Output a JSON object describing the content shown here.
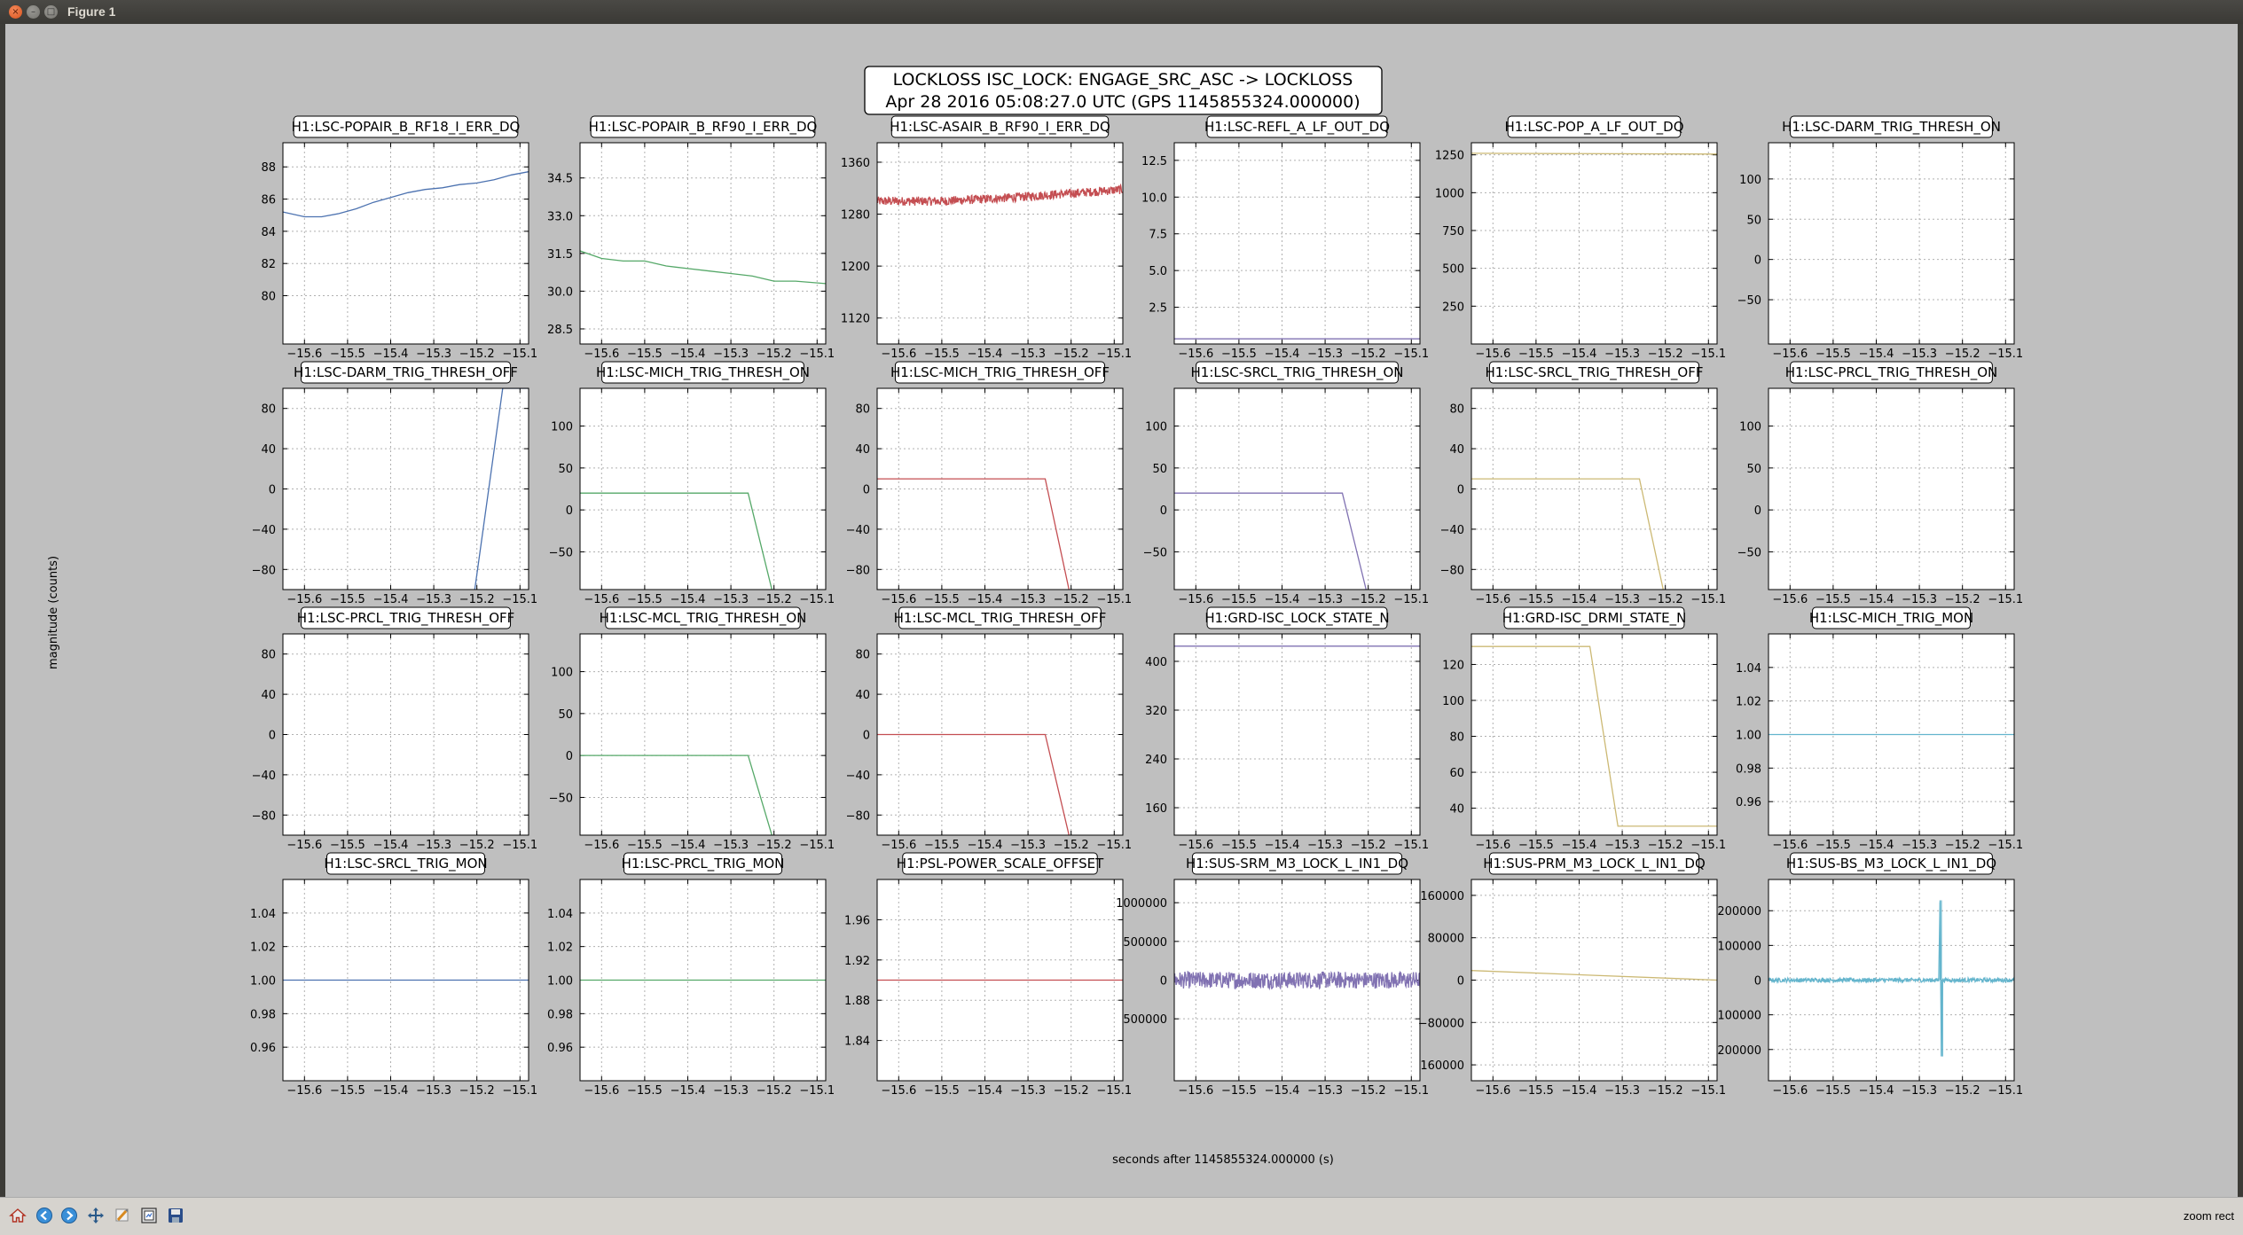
{
  "window": {
    "title": "Figure 1"
  },
  "figure": {
    "suptitle_line1": "LOCKLOSS ISC_LOCK: ENGAGE_SRC_ASC -> LOCKLOSS",
    "suptitle_line2": "Apr 28 2016 05:08:27.0 UTC (GPS 1145855324.000000)",
    "ylabel": "magnitude (counts)",
    "xlabel": "seconds after 1145855324.000000 (s)"
  },
  "toolbar": {
    "status": "zoom rect",
    "icons": [
      "home-icon",
      "back-icon",
      "forward-icon",
      "pan-icon",
      "zoom-icon",
      "subplots-icon",
      "save-icon"
    ]
  },
  "chart_data": [
    {
      "type": "line",
      "title": "H1:LSC-POPAIR_B_RF18_I_ERR_DQ",
      "color": "#4c72b0",
      "xlim": [
        -15.65,
        -15.08
      ],
      "ylim": [
        77,
        89.5
      ],
      "xticks": [
        -15.6,
        -15.5,
        -15.4,
        -15.3,
        -15.2,
        -15.1
      ],
      "xtick_labels": [
        "−15.6",
        "−15.5",
        "−15.4",
        "−15.3",
        "−15.2",
        "−15.1"
      ],
      "yticks": [
        80,
        82,
        84,
        86,
        88
      ],
      "ytick_labels": [
        "80",
        "82",
        "84",
        "86",
        "88"
      ],
      "x": [
        -15.65,
        -15.6,
        -15.56,
        -15.52,
        -15.48,
        -15.44,
        -15.4,
        -15.36,
        -15.32,
        -15.28,
        -15.24,
        -15.2,
        -15.16,
        -15.12,
        -15.08
      ],
      "y": [
        85.2,
        84.9,
        84.9,
        85.1,
        85.4,
        85.8,
        86.1,
        86.4,
        86.6,
        86.7,
        86.9,
        87.0,
        87.2,
        87.5,
        87.7
      ]
    },
    {
      "type": "line",
      "title": "H1:LSC-POPAIR_B_RF90_I_ERR_DQ",
      "color": "#55a868",
      "xlim": [
        -15.65,
        -15.08
      ],
      "ylim": [
        27.9,
        35.9
      ],
      "xticks": [
        -15.6,
        -15.5,
        -15.4,
        -15.3,
        -15.2,
        -15.1
      ],
      "xtick_labels": [
        "−15.6",
        "−15.5",
        "−15.4",
        "−15.3",
        "−15.2",
        "−15.1"
      ],
      "yticks": [
        28.5,
        30.0,
        31.5,
        33.0,
        34.5
      ],
      "ytick_labels": [
        "28.5",
        "30.0",
        "31.5",
        "33.0",
        "34.5"
      ],
      "x": [
        -15.65,
        -15.6,
        -15.55,
        -15.5,
        -15.45,
        -15.4,
        -15.35,
        -15.3,
        -15.25,
        -15.2,
        -15.15,
        -15.08
      ],
      "y": [
        31.6,
        31.3,
        31.2,
        31.2,
        31.0,
        30.9,
        30.8,
        30.7,
        30.6,
        30.4,
        30.4,
        30.3
      ]
    },
    {
      "type": "line",
      "title": "H1:LSC-ASAIR_B_RF90_I_ERR_DQ",
      "color": "#c44e52",
      "xlim": [
        -15.65,
        -15.08
      ],
      "ylim": [
        1080,
        1390
      ],
      "xticks": [
        -15.6,
        -15.5,
        -15.4,
        -15.3,
        -15.2,
        -15.1
      ],
      "xtick_labels": [
        "−15.6",
        "−15.5",
        "−15.4",
        "−15.3",
        "−15.2",
        "−15.1"
      ],
      "yticks": [
        1120,
        1200,
        1280,
        1360
      ],
      "ytick_labels": [
        "1120",
        "1200",
        "1280",
        "1360"
      ],
      "noise": "dense",
      "x": [
        -15.65,
        -15.5,
        -15.35,
        -15.2,
        -15.08
      ],
      "y": [
        1300,
        1300,
        1305,
        1312,
        1318
      ],
      "noise_amplitude": 7
    },
    {
      "type": "line",
      "title": "H1:LSC-REFL_A_LF_OUT_DQ",
      "color": "#8172b2",
      "xlim": [
        -15.65,
        -15.08
      ],
      "ylim": [
        0,
        13.7
      ],
      "xticks": [
        -15.6,
        -15.5,
        -15.4,
        -15.3,
        -15.2,
        -15.1
      ],
      "xtick_labels": [
        "−15.6",
        "−15.5",
        "−15.4",
        "−15.3",
        "−15.2",
        "−15.1"
      ],
      "yticks": [
        2.5,
        5.0,
        7.5,
        10.0,
        12.5
      ],
      "ytick_labels": [
        "2.5",
        "5.0",
        "7.5",
        "10.0",
        "12.5"
      ],
      "x": [
        -15.65,
        -15.08
      ],
      "y": [
        0.35,
        0.35
      ]
    },
    {
      "type": "line",
      "title": "H1:LSC-POP_A_LF_OUT_DQ",
      "color": "#ccb974",
      "xlim": [
        -15.65,
        -15.08
      ],
      "ylim": [
        0,
        1330
      ],
      "xticks": [
        -15.6,
        -15.5,
        -15.4,
        -15.3,
        -15.2,
        -15.1
      ],
      "xtick_labels": [
        "−15.6",
        "−15.5",
        "−15.4",
        "−15.3",
        "−15.2",
        "−15.1"
      ],
      "yticks": [
        250,
        500,
        750,
        1000,
        1250
      ],
      "ytick_labels": [
        "250",
        "500",
        "750",
        "1000",
        "1250"
      ],
      "x": [
        -15.65,
        -15.08
      ],
      "y": [
        1260,
        1255
      ]
    },
    {
      "type": "line",
      "title": "H1:LSC-DARM_TRIG_THRESH_ON",
      "color": "#64b5cd",
      "xlim": [
        -15.65,
        -15.08
      ],
      "ylim": [
        -105,
        145
      ],
      "xticks": [
        -15.6,
        -15.5,
        -15.4,
        -15.3,
        -15.2,
        -15.1
      ],
      "xtick_labels": [
        "−15.6",
        "−15.5",
        "−15.4",
        "−15.3",
        "−15.2",
        "−15.1"
      ],
      "yticks": [
        -50,
        0,
        50,
        100
      ],
      "ytick_labels": [
        "−50",
        "0",
        "50",
        "100"
      ],
      "x": [],
      "y": []
    },
    {
      "type": "line",
      "title": "H1:LSC-DARM_TRIG_THRESH_OFF",
      "color": "#4c72b0",
      "xlim": [
        -15.65,
        -15.08
      ],
      "ylim": [
        -100,
        100
      ],
      "xticks": [
        -15.6,
        -15.5,
        -15.4,
        -15.3,
        -15.2,
        -15.1
      ],
      "xtick_labels": [
        "−15.6",
        "−15.5",
        "−15.4",
        "−15.3",
        "−15.2",
        "−15.1"
      ],
      "yticks": [
        -80,
        -40,
        0,
        40,
        80
      ],
      "ytick_labels": [
        "−80",
        "−40",
        "0",
        "40",
        "80"
      ],
      "x": [
        -15.205,
        -15.14,
        -15.08
      ],
      "y": [
        -100,
        100,
        100
      ]
    },
    {
      "type": "line",
      "title": "H1:LSC-MICH_TRIG_THRESH_ON",
      "color": "#55a868",
      "xlim": [
        -15.65,
        -15.08
      ],
      "ylim": [
        -95,
        145
      ],
      "xticks": [
        -15.6,
        -15.5,
        -15.4,
        -15.3,
        -15.2,
        -15.1
      ],
      "xtick_labels": [
        "−15.6",
        "−15.5",
        "−15.4",
        "−15.3",
        "−15.2",
        "−15.1"
      ],
      "yticks": [
        -50,
        0,
        50,
        100
      ],
      "ytick_labels": [
        "−50",
        "0",
        "50",
        "100"
      ],
      "x": [
        -15.65,
        -15.26,
        -15.205
      ],
      "y": [
        20,
        20,
        -95
      ]
    },
    {
      "type": "line",
      "title": "H1:LSC-MICH_TRIG_THRESH_OFF",
      "color": "#c44e52",
      "xlim": [
        -15.65,
        -15.08
      ],
      "ylim": [
        -100,
        100
      ],
      "xticks": [
        -15.6,
        -15.5,
        -15.4,
        -15.3,
        -15.2,
        -15.1
      ],
      "xtick_labels": [
        "−15.6",
        "−15.5",
        "−15.4",
        "−15.3",
        "−15.2",
        "−15.1"
      ],
      "yticks": [
        -80,
        -40,
        0,
        40,
        80
      ],
      "ytick_labels": [
        "−80",
        "−40",
        "0",
        "40",
        "80"
      ],
      "x": [
        -15.65,
        -15.26,
        -15.205
      ],
      "y": [
        10,
        10,
        -100
      ]
    },
    {
      "type": "line",
      "title": "H1:LSC-SRCL_TRIG_THRESH_ON",
      "color": "#8172b2",
      "xlim": [
        -15.65,
        -15.08
      ],
      "ylim": [
        -95,
        145
      ],
      "xticks": [
        -15.6,
        -15.5,
        -15.4,
        -15.3,
        -15.2,
        -15.1
      ],
      "xtick_labels": [
        "−15.6",
        "−15.5",
        "−15.4",
        "−15.3",
        "−15.2",
        "−15.1"
      ],
      "yticks": [
        -50,
        0,
        50,
        100
      ],
      "ytick_labels": [
        "−50",
        "0",
        "50",
        "100"
      ],
      "x": [
        -15.65,
        -15.26,
        -15.205
      ],
      "y": [
        20,
        20,
        -95
      ]
    },
    {
      "type": "line",
      "title": "H1:LSC-SRCL_TRIG_THRESH_OFF",
      "color": "#ccb974",
      "xlim": [
        -15.65,
        -15.08
      ],
      "ylim": [
        -100,
        100
      ],
      "xticks": [
        -15.6,
        -15.5,
        -15.4,
        -15.3,
        -15.2,
        -15.1
      ],
      "xtick_labels": [
        "−15.6",
        "−15.5",
        "−15.4",
        "−15.3",
        "−15.2",
        "−15.1"
      ],
      "yticks": [
        -80,
        -40,
        0,
        40,
        80
      ],
      "ytick_labels": [
        "−80",
        "−40",
        "0",
        "40",
        "80"
      ],
      "x": [
        -15.65,
        -15.26,
        -15.205
      ],
      "y": [
        10,
        10,
        -100
      ]
    },
    {
      "type": "line",
      "title": "H1:LSC-PRCL_TRIG_THRESH_ON",
      "color": "#64b5cd",
      "xlim": [
        -15.65,
        -15.08
      ],
      "ylim": [
        -95,
        145
      ],
      "xticks": [
        -15.6,
        -15.5,
        -15.4,
        -15.3,
        -15.2,
        -15.1
      ],
      "xtick_labels": [
        "−15.6",
        "−15.5",
        "−15.4",
        "−15.3",
        "−15.2",
        "−15.1"
      ],
      "yticks": [
        -50,
        0,
        50,
        100
      ],
      "ytick_labels": [
        "−50",
        "0",
        "50",
        "100"
      ],
      "x": [],
      "y": []
    },
    {
      "type": "line",
      "title": "H1:LSC-PRCL_TRIG_THRESH_OFF",
      "color": "#4c72b0",
      "xlim": [
        -15.65,
        -15.08
      ],
      "ylim": [
        -100,
        100
      ],
      "xticks": [
        -15.6,
        -15.5,
        -15.4,
        -15.3,
        -15.2,
        -15.1
      ],
      "xtick_labels": [
        "−15.6",
        "−15.5",
        "−15.4",
        "−15.3",
        "−15.2",
        "−15.1"
      ],
      "yticks": [
        -80,
        -40,
        0,
        40,
        80
      ],
      "ytick_labels": [
        "−80",
        "−40",
        "0",
        "40",
        "80"
      ],
      "x": [],
      "y": []
    },
    {
      "type": "line",
      "title": "H1:LSC-MCL_TRIG_THRESH_ON",
      "color": "#55a868",
      "xlim": [
        -15.65,
        -15.08
      ],
      "ylim": [
        -95,
        145
      ],
      "xticks": [
        -15.6,
        -15.5,
        -15.4,
        -15.3,
        -15.2,
        -15.1
      ],
      "xtick_labels": [
        "−15.6",
        "−15.5",
        "−15.4",
        "−15.3",
        "−15.2",
        "−15.1"
      ],
      "yticks": [
        -50,
        0,
        50,
        100
      ],
      "ytick_labels": [
        "−50",
        "0",
        "50",
        "100"
      ],
      "x": [
        -15.65,
        -15.26,
        -15.205
      ],
      "y": [
        0,
        0,
        -95
      ]
    },
    {
      "type": "line",
      "title": "H1:LSC-MCL_TRIG_THRESH_OFF",
      "color": "#c44e52",
      "xlim": [
        -15.65,
        -15.08
      ],
      "ylim": [
        -100,
        100
      ],
      "xticks": [
        -15.6,
        -15.5,
        -15.4,
        -15.3,
        -15.2,
        -15.1
      ],
      "xtick_labels": [
        "−15.6",
        "−15.5",
        "−15.4",
        "−15.3",
        "−15.2",
        "−15.1"
      ],
      "yticks": [
        -80,
        -40,
        0,
        40,
        80
      ],
      "ytick_labels": [
        "−80",
        "−40",
        "0",
        "40",
        "80"
      ],
      "x": [
        -15.65,
        -15.26,
        -15.205
      ],
      "y": [
        0,
        0,
        -100
      ]
    },
    {
      "type": "line",
      "title": "H1:GRD-ISC_LOCK_STATE_N",
      "color": "#8172b2",
      "xlim": [
        -15.65,
        -15.08
      ],
      "ylim": [
        115,
        445
      ],
      "xticks": [
        -15.6,
        -15.5,
        -15.4,
        -15.3,
        -15.2,
        -15.1
      ],
      "xtick_labels": [
        "−15.6",
        "−15.5",
        "−15.4",
        "−15.3",
        "−15.2",
        "−15.1"
      ],
      "yticks": [
        160,
        240,
        320,
        400
      ],
      "ytick_labels": [
        "160",
        "240",
        "320",
        "400"
      ],
      "x": [
        -15.65,
        -15.08
      ],
      "y": [
        425,
        425
      ]
    },
    {
      "type": "line",
      "title": "H1:GRD-ISC_DRMI_STATE_N",
      "color": "#ccb974",
      "xlim": [
        -15.65,
        -15.08
      ],
      "ylim": [
        25,
        137
      ],
      "xticks": [
        -15.6,
        -15.5,
        -15.4,
        -15.3,
        -15.2,
        -15.1
      ],
      "xtick_labels": [
        "−15.6",
        "−15.5",
        "−15.4",
        "−15.3",
        "−15.2",
        "−15.1"
      ],
      "yticks": [
        40,
        60,
        80,
        100,
        120
      ],
      "ytick_labels": [
        "40",
        "60",
        "80",
        "100",
        "120"
      ],
      "x": [
        -15.65,
        -15.375,
        -15.31,
        -15.08
      ],
      "y": [
        130,
        130,
        30,
        30
      ]
    },
    {
      "type": "line",
      "title": "H1:LSC-MICH_TRIG_MON",
      "color": "#64b5cd",
      "xlim": [
        -15.65,
        -15.08
      ],
      "ylim": [
        0.94,
        1.06
      ],
      "xticks": [
        -15.6,
        -15.5,
        -15.4,
        -15.3,
        -15.2,
        -15.1
      ],
      "xtick_labels": [
        "−15.6",
        "−15.5",
        "−15.4",
        "−15.3",
        "−15.2",
        "−15.1"
      ],
      "yticks": [
        0.96,
        0.98,
        1.0,
        1.02,
        1.04
      ],
      "ytick_labels": [
        "0.96",
        "0.98",
        "1.00",
        "1.02",
        "1.04"
      ],
      "x": [
        -15.65,
        -15.08
      ],
      "y": [
        1.0,
        1.0
      ]
    },
    {
      "type": "line",
      "title": "H1:LSC-SRCL_TRIG_MON",
      "color": "#4c72b0",
      "xlim": [
        -15.65,
        -15.08
      ],
      "ylim": [
        0.94,
        1.06
      ],
      "xticks": [
        -15.6,
        -15.5,
        -15.4,
        -15.3,
        -15.2,
        -15.1
      ],
      "xtick_labels": [
        "−15.6",
        "−15.5",
        "−15.4",
        "−15.3",
        "−15.2",
        "−15.1"
      ],
      "yticks": [
        0.96,
        0.98,
        1.0,
        1.02,
        1.04
      ],
      "ytick_labels": [
        "0.96",
        "0.98",
        "1.00",
        "1.02",
        "1.04"
      ],
      "x": [
        -15.65,
        -15.08
      ],
      "y": [
        1.0,
        1.0
      ]
    },
    {
      "type": "line",
      "title": "H1:LSC-PRCL_TRIG_MON",
      "color": "#55a868",
      "xlim": [
        -15.65,
        -15.08
      ],
      "ylim": [
        0.94,
        1.06
      ],
      "xticks": [
        -15.6,
        -15.5,
        -15.4,
        -15.3,
        -15.2,
        -15.1
      ],
      "xtick_labels": [
        "−15.6",
        "−15.5",
        "−15.4",
        "−15.3",
        "−15.2",
        "−15.1"
      ],
      "yticks": [
        0.96,
        0.98,
        1.0,
        1.02,
        1.04
      ],
      "ytick_labels": [
        "0.96",
        "0.98",
        "1.00",
        "1.02",
        "1.04"
      ],
      "x": [
        -15.65,
        -15.08
      ],
      "y": [
        1.0,
        1.0
      ]
    },
    {
      "type": "line",
      "title": "H1:PSL-POWER_SCALE_OFFSET",
      "color": "#c44e52",
      "xlim": [
        -15.65,
        -15.08
      ],
      "ylim": [
        1.8,
        2.0
      ],
      "xticks": [
        -15.6,
        -15.5,
        -15.4,
        -15.3,
        -15.2,
        -15.1
      ],
      "xtick_labels": [
        "−15.6",
        "−15.5",
        "−15.4",
        "−15.3",
        "−15.2",
        "−15.1"
      ],
      "yticks": [
        1.84,
        1.88,
        1.92,
        1.96
      ],
      "ytick_labels": [
        "1.84",
        "1.88",
        "1.92",
        "1.96"
      ],
      "x": [
        -15.65,
        -15.08
      ],
      "y": [
        1.9,
        1.9
      ]
    },
    {
      "type": "line",
      "title": "H1:SUS-SRM_M3_LOCK_L_IN1_DQ",
      "color": "#8172b2",
      "xlim": [
        -15.65,
        -15.08
      ],
      "ylim": [
        -1300000,
        1300000
      ],
      "xticks": [
        -15.6,
        -15.5,
        -15.4,
        -15.3,
        -15.2,
        -15.1
      ],
      "xtick_labels": [
        "−15.6",
        "−15.5",
        "−15.4",
        "−15.3",
        "−15.2",
        "−15.1"
      ],
      "yticks": [
        -500000,
        0,
        500000,
        1000000
      ],
      "ytick_labels": [
        "500000",
        "0",
        "500000",
        "1000000"
      ],
      "noise": "dense",
      "x": [
        -15.65,
        -15.08
      ],
      "y": [
        0,
        0
      ],
      "noise_amplitude": 110000
    },
    {
      "type": "line",
      "title": "H1:SUS-PRM_M3_LOCK_L_IN1_DQ",
      "color": "#ccb974",
      "xlim": [
        -15.65,
        -15.08
      ],
      "ylim": [
        -190000,
        190000
      ],
      "xticks": [
        -15.6,
        -15.5,
        -15.4,
        -15.3,
        -15.2,
        -15.1
      ],
      "xtick_labels": [
        "−15.6",
        "−15.5",
        "−15.4",
        "−15.3",
        "−15.2",
        "−15.1"
      ],
      "yticks": [
        -160000,
        -80000,
        0,
        80000,
        160000
      ],
      "ytick_labels": [
        "160000",
        "−80000",
        "0",
        "80000",
        "160000"
      ],
      "x": [
        -15.65,
        -15.08
      ],
      "y": [
        18000,
        0
      ]
    },
    {
      "type": "line",
      "title": "H1:SUS-BS_M3_LOCK_L_IN1_DQ",
      "color": "#64b5cd",
      "xlim": [
        -15.65,
        -15.08
      ],
      "ylim": [
        -290000,
        290000
      ],
      "xticks": [
        -15.6,
        -15.5,
        -15.4,
        -15.3,
        -15.2,
        -15.1
      ],
      "xtick_labels": [
        "−15.6",
        "−15.5",
        "−15.4",
        "−15.3",
        "−15.2",
        "−15.1"
      ],
      "yticks": [
        -200000,
        -100000,
        0,
        100000,
        200000
      ],
      "ytick_labels": [
        "200000",
        "100000",
        "0",
        "100000",
        "200000"
      ],
      "noise": "dense",
      "x": [
        -15.65,
        -15.255,
        -15.252,
        -15.249,
        -15.246,
        -15.08
      ],
      "y": [
        0,
        0,
        230000,
        -220000,
        0,
        0
      ],
      "noise_amplitude": 6000
    }
  ]
}
